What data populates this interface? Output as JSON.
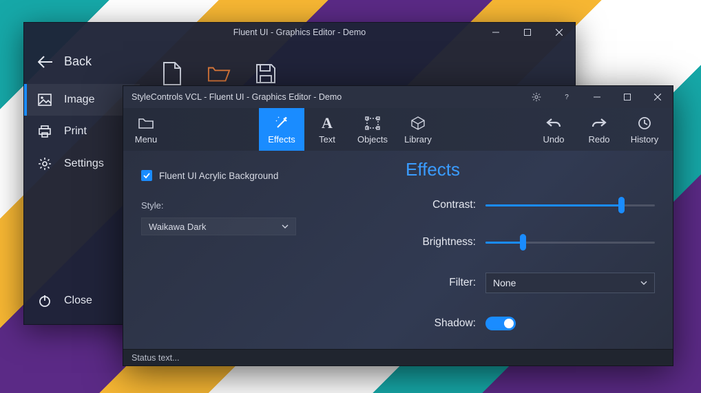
{
  "win1": {
    "title": "Fluent UI - Graphics Editor - Demo",
    "back": "Back",
    "nav": {
      "image": "Image",
      "print": "Print",
      "settings": "Settings",
      "close": "Close"
    }
  },
  "win2": {
    "title": "StyleControls VCL - Fluent UI - Graphics Editor - Demo",
    "ribbon": {
      "menu": "Menu",
      "effects": "Effects",
      "text": "Text",
      "objects": "Objects",
      "library": "Library",
      "undo": "Undo",
      "redo": "Redo",
      "history": "History"
    },
    "left_panel": {
      "acrylic_label": "Fluent UI Acrylic Background",
      "style_label": "Style:",
      "style_value": "Waikawa Dark"
    },
    "effects": {
      "title": "Effects",
      "contrast_label": "Contrast:",
      "contrast_pct": 80,
      "brightness_label": "Brightness:",
      "brightness_pct": 22,
      "filter_label": "Filter:",
      "filter_value": "None",
      "shadow_label": "Shadow:",
      "shadow_on": true
    },
    "status": "Status text..."
  },
  "glyphs": {
    "help": "?"
  }
}
